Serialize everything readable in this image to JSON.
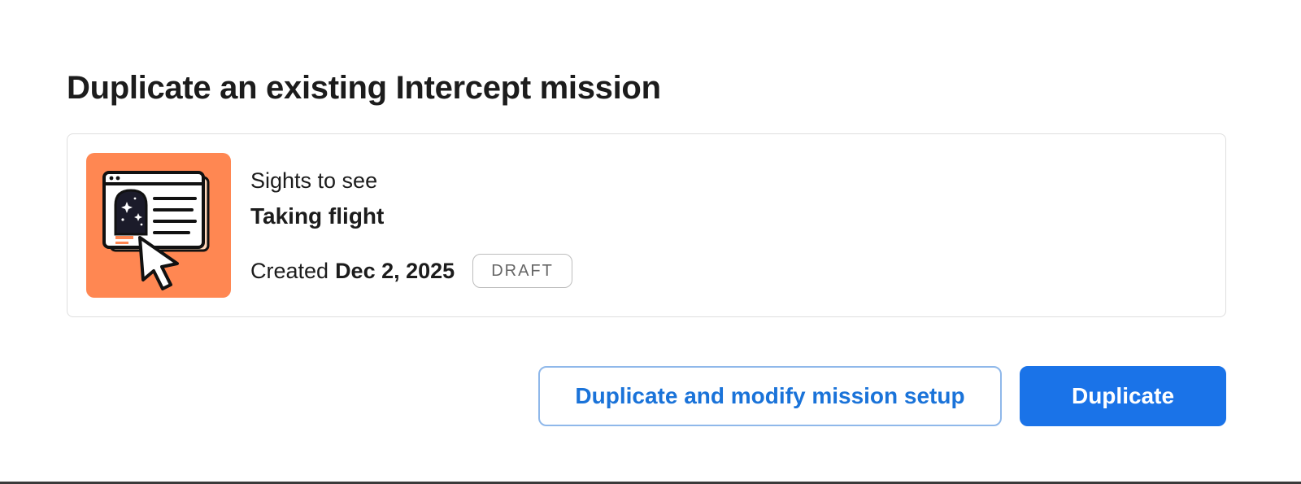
{
  "page": {
    "title": "Duplicate an existing Intercept mission"
  },
  "mission": {
    "thumbnail_icon": "browser-window-cursor-illustration",
    "thumbnail_color": "#ff8752",
    "category": "Sights to see",
    "name": "Taking flight",
    "created_label": "Created",
    "created_date": "Dec 2, 2025",
    "status": "DRAFT"
  },
  "actions": {
    "modify_label": "Duplicate and modify mission setup",
    "duplicate_label": "Duplicate"
  },
  "colors": {
    "primary": "#1a73e8",
    "secondary_border": "#8fb8ea",
    "text": "#1c1c1c"
  }
}
